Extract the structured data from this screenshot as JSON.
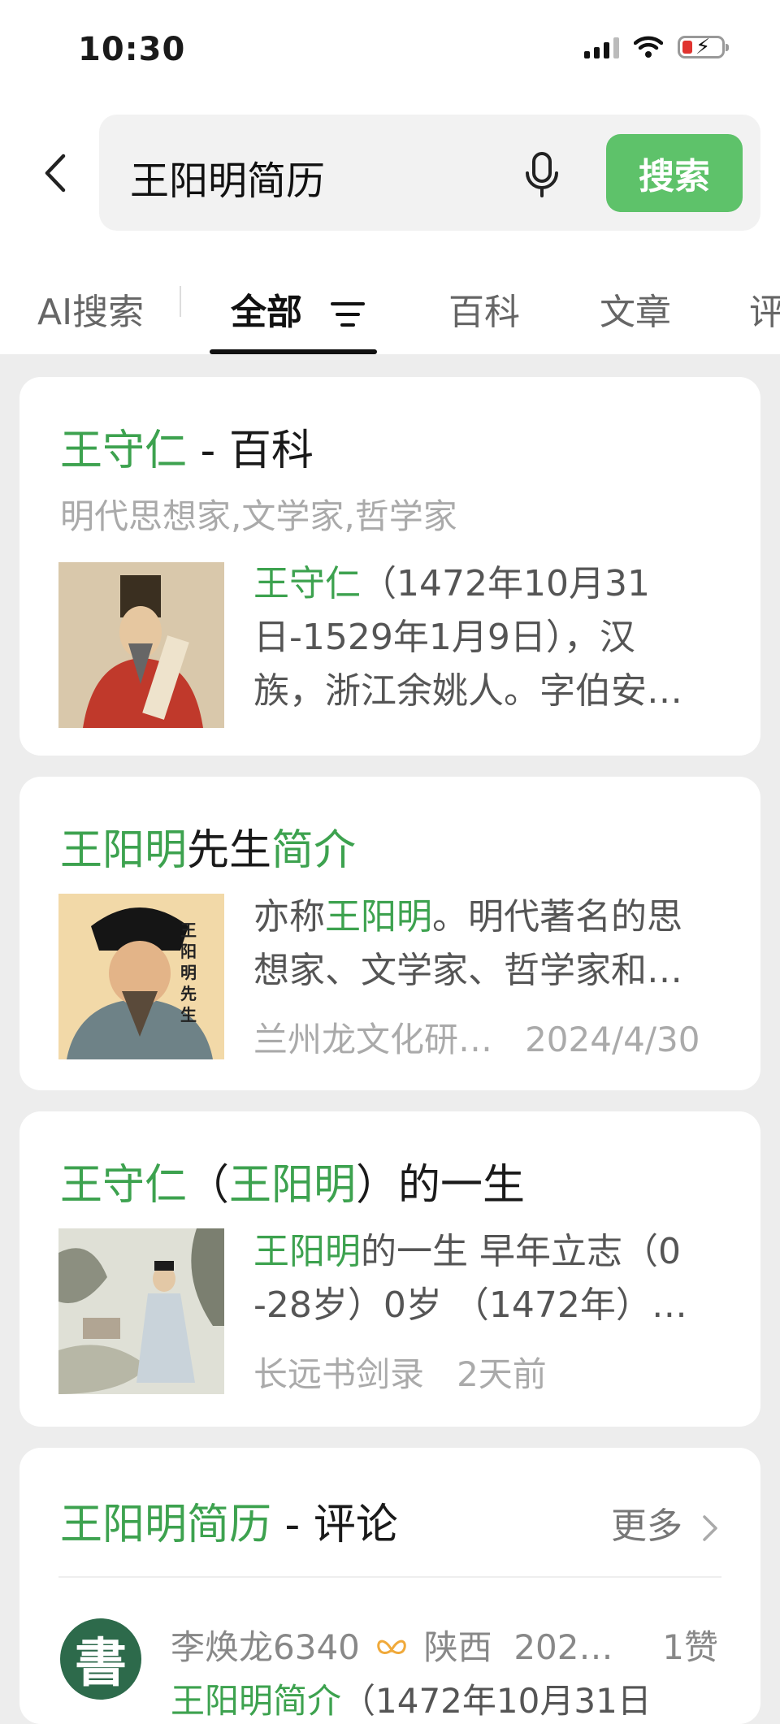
{
  "status_bar": {
    "time": "10:30"
  },
  "search": {
    "query": "王阳明简历",
    "button_label": "搜索"
  },
  "tabs": [
    {
      "label": "AI搜索"
    },
    {
      "label": "全部"
    },
    {
      "label": "百科"
    },
    {
      "label": "文章"
    },
    {
      "label": "评"
    }
  ],
  "results": [
    {
      "title_hl": "王守仁",
      "title_rest": " - 百科",
      "subtitle": "明代思想家,文学家,哲学家",
      "snippet_hl": "王守仁",
      "snippet_line1": "（1472年10月31",
      "snippet_line2": "日-1529年1月9日），汉",
      "snippet_line3": "族，浙江余姚人。字伯安…"
    },
    {
      "title_a": "王阳明",
      "title_b": "先生",
      "title_c": "简介",
      "snippet_pre": "亦称",
      "snippet_hl": "王阳明",
      "snippet_post": "。明代著名的思",
      "snippet_line2": "想家、文学家、哲学家和…",
      "source": "兰州龙文化研…",
      "date": "2024/4/30"
    },
    {
      "title_a": "王守仁",
      "title_b": "（",
      "title_c": "王阳明",
      "title_d": "）的一生",
      "snippet_hl": "王阳明",
      "snippet_post": "的一生 早年立志（0",
      "snippet_line2": "-28岁）0岁 （1472年）…",
      "source": "长远书剑录",
      "date": "2天前"
    }
  ],
  "comments_section": {
    "title_hl": "王阳明简历",
    "title_rest": " - 评论",
    "more_label": "更多",
    "comment": {
      "avatar_char": "書",
      "user": "李焕龙6340",
      "location": "陕西",
      "date": "202…",
      "likes": "1赞",
      "text_hl": "王阳明简介",
      "text_rest": "（1472年10月31日"
    }
  },
  "colors": {
    "accent": "#3da24f",
    "button": "#5ec26a"
  }
}
